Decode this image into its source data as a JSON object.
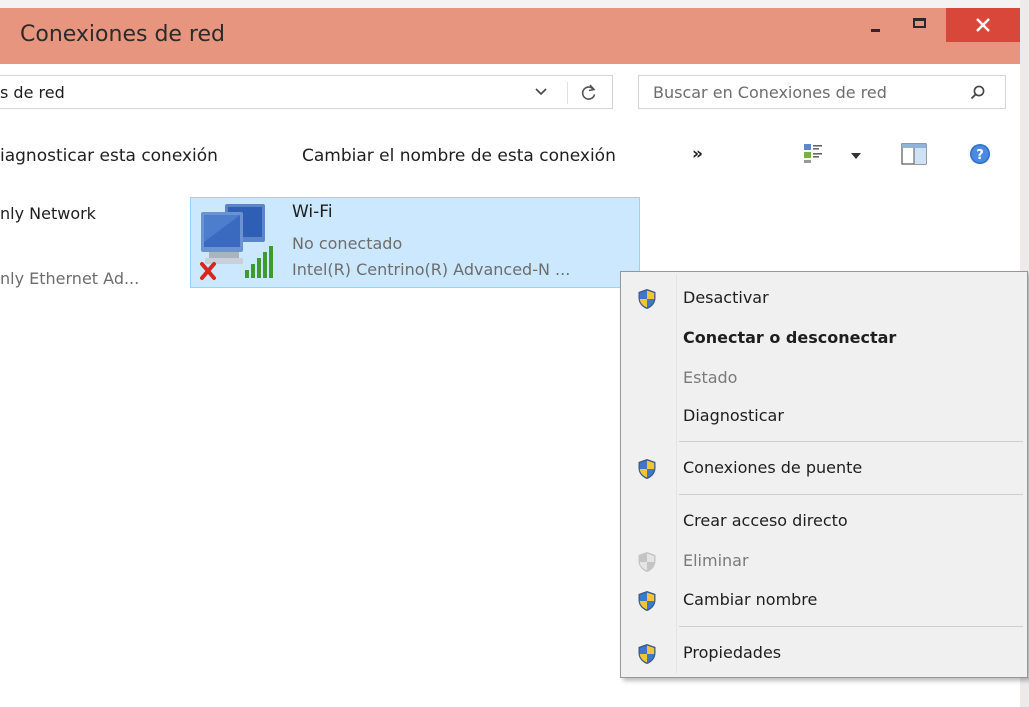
{
  "window": {
    "title": "Conexiones de red",
    "colors": {
      "titlebar": "#e8957f",
      "close_button": "#d9473a",
      "selection": "#cce8ff"
    }
  },
  "address": {
    "path_text": "s de red",
    "search_placeholder": "Buscar en Conexiones de red"
  },
  "commands": {
    "diagnose": "iagnosticar esta conexión",
    "rename": "Cambiar el nombre de esta conexión",
    "more": "»"
  },
  "items": [
    {
      "name": "nly Network",
      "device": "nly Ethernet Ad..."
    },
    {
      "name": "Wi-Fi",
      "status": "No conectado",
      "device": "Intel(R) Centrino(R) Advanced-N ...",
      "selected": true
    }
  ],
  "context_menu": {
    "items": [
      {
        "label": "Desactivar",
        "icon": "uac-shield-icon"
      },
      {
        "label": "Conectar o desconectar",
        "bold": true
      },
      {
        "label": "Estado",
        "disabled": true
      },
      {
        "label": "Diagnosticar"
      },
      {
        "label": "Conexiones de puente",
        "icon": "uac-shield-icon"
      },
      {
        "label": "Crear acceso directo"
      },
      {
        "label": "Eliminar",
        "icon": "uac-shield-icon",
        "disabled": true
      },
      {
        "label": "Cambiar nombre",
        "icon": "uac-shield-icon"
      },
      {
        "label": "Propiedades",
        "icon": "uac-shield-icon"
      }
    ]
  }
}
